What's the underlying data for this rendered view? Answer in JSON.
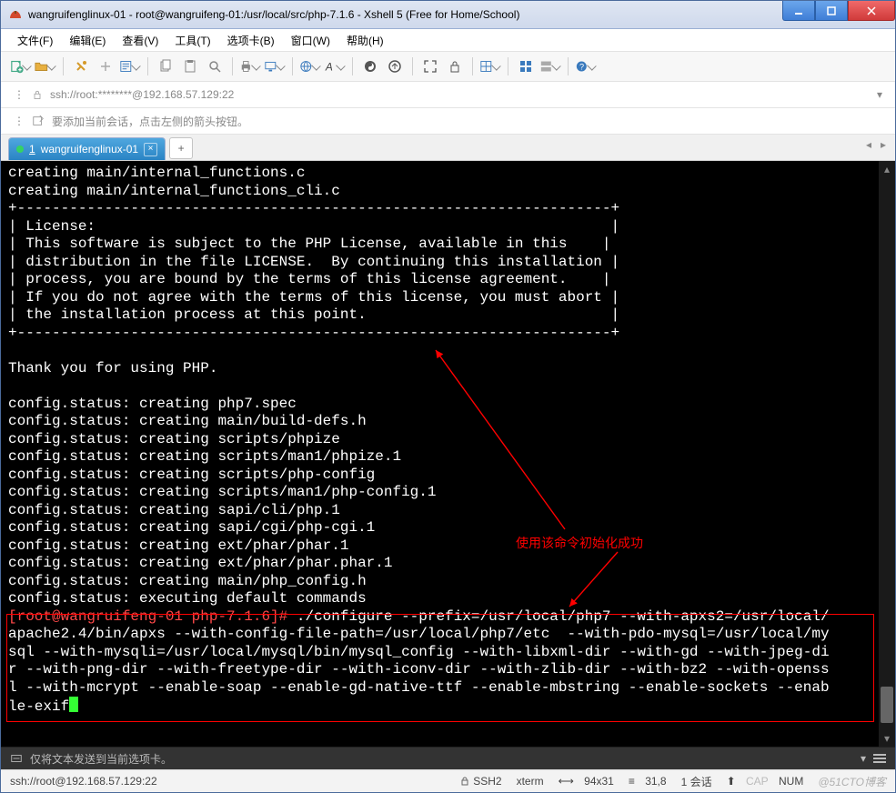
{
  "window": {
    "title": "wangruifenglinux-01 - root@wangruifeng-01:/usr/local/src/php-7.1.6 - Xshell 5 (Free for Home/School)"
  },
  "menu": {
    "file": "文件(F)",
    "edit": "编辑(E)",
    "view": "查看(V)",
    "tools": "工具(T)",
    "tabs": "选项卡(B)",
    "window": "窗口(W)",
    "help": "帮助(H)"
  },
  "address": {
    "text": "ssh://root:********@192.168.57.129:22"
  },
  "hint": {
    "text": "要添加当前会话，点击左侧的箭头按钮。"
  },
  "tab": {
    "index": "1",
    "label": "wangruifenglinux-01"
  },
  "annotation": {
    "label": "使用该命令初始化成功"
  },
  "terminal": {
    "l01": "creating main/internal_functions.c",
    "l02": "creating main/internal_functions_cli.c",
    "l03": "+--------------------------------------------------------------------+",
    "l04": "| License:                                                           |",
    "l05": "| This software is subject to the PHP License, available in this    |",
    "l06": "| distribution in the file LICENSE.  By continuing this installation |",
    "l07": "| process, you are bound by the terms of this license agreement.    |",
    "l08": "| If you do not agree with the terms of this license, you must abort |",
    "l09": "| the installation process at this point.                            |",
    "l10": "+--------------------------------------------------------------------+",
    "l11": "",
    "l12": "Thank you for using PHP.",
    "l13": "",
    "l14": "config.status: creating php7.spec",
    "l15": "config.status: creating main/build-defs.h",
    "l16": "config.status: creating scripts/phpize",
    "l17": "config.status: creating scripts/man1/phpize.1",
    "l18": "config.status: creating scripts/php-config",
    "l19": "config.status: creating scripts/man1/php-config.1",
    "l20": "config.status: creating sapi/cli/php.1",
    "l21": "config.status: creating sapi/cgi/php-cgi.1",
    "l22": "config.status: creating ext/phar/phar.1",
    "l23": "config.status: creating ext/phar/phar.phar.1",
    "l24": "config.status: creating main/php_config.h",
    "l25": "config.status: executing default commands",
    "prompt": "[root@wangruifeng-01 php-7.1.6]# ",
    "cmd1": "./configure --prefix=/usr/local/php7 --with-apxs2=/usr/local/",
    "cmd2": "apache2.4/bin/apxs --with-config-file-path=/usr/local/php7/etc  --with-pdo-mysql=/usr/local/my",
    "cmd3": "sql --with-mysqli=/usr/local/mysql/bin/mysql_config --with-libxml-dir --with-gd --with-jpeg-di",
    "cmd4": "r --with-png-dir --with-freetype-dir --with-iconv-dir --with-zlib-dir --with-bz2 --with-openss",
    "cmd5": "l --with-mcrypt --enable-soap --enable-gd-native-ttf --enable-mbstring --enable-sockets --enab",
    "cmd6": "le-exif"
  },
  "inputbar": {
    "text": "仅将文本发送到当前选项卡。"
  },
  "status": {
    "left": "ssh://root@192.168.57.129:22",
    "ssh": "SSH2",
    "term": "xterm",
    "size": "94x31",
    "pos": "31,8",
    "sess": "1 会话",
    "cap": "CAP",
    "num": "NUM"
  },
  "watermark": "@51CTO博客"
}
